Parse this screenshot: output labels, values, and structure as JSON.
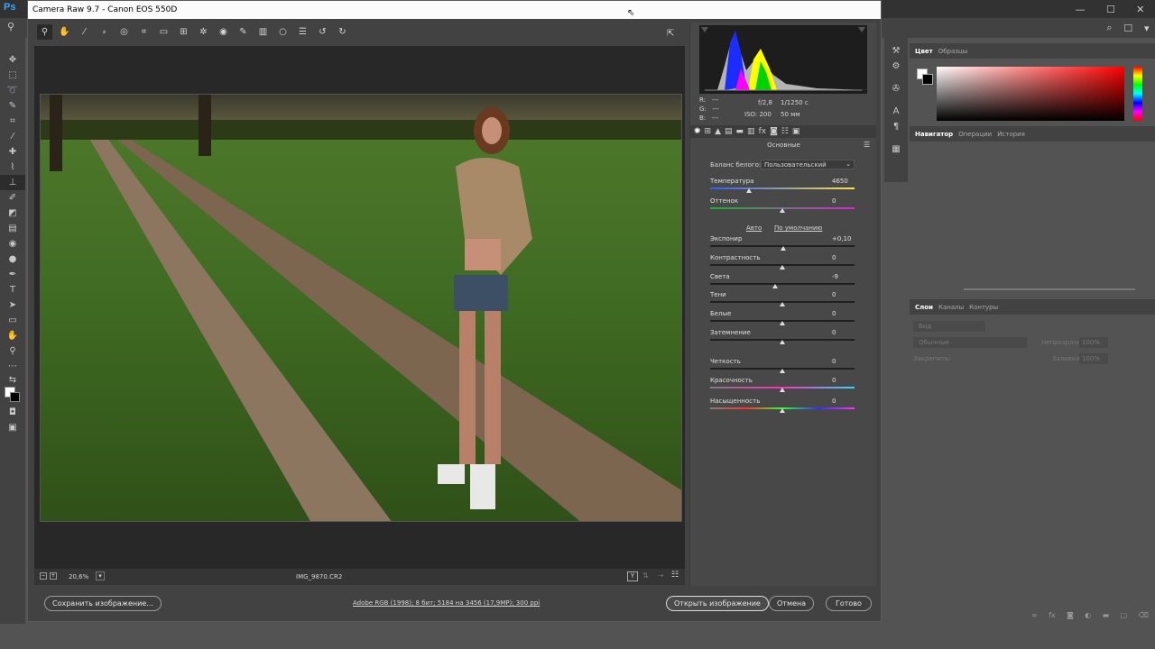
{
  "ps": {
    "logo": "Ps",
    "controls": [
      "—",
      "☐",
      "✕"
    ],
    "right_icons": [
      "⌕",
      "☐",
      "▾"
    ]
  },
  "acr": {
    "title": "Camera Raw 9.7  -  Canon EOS 550D",
    "preview": {
      "zoom": "20,6%",
      "filename": "IMG_9870.CR2"
    },
    "histogram": {
      "rgb": [
        {
          "k": "R:",
          "v": "---"
        },
        {
          "k": "G:",
          "v": "---"
        },
        {
          "k": "B:",
          "v": "---"
        }
      ],
      "aperture": "f/2,8",
      "shutter": "1/1250 с",
      "iso": "ISO: 200",
      "focal": "50 мм"
    },
    "panel_title": "Основные",
    "wb_label": "Баланс белого:",
    "wb_value": "Пользовательский",
    "auto": "Авто",
    "defaults": "По умолчанию",
    "sliders": [
      {
        "label": "Температура",
        "value": "4650",
        "pos": 0.27,
        "style": "temp"
      },
      {
        "label": "Оттенок",
        "value": "0",
        "pos": 0.5,
        "style": "tint"
      },
      {
        "label": "Экспонир",
        "value": "+0,10",
        "pos": 0.505,
        "style": "gray"
      },
      {
        "label": "Контрастность",
        "value": "0",
        "pos": 0.5,
        "style": "gray"
      },
      {
        "label": "Света",
        "value": "-9",
        "pos": 0.45,
        "style": "gray"
      },
      {
        "label": "Тени",
        "value": "0",
        "pos": 0.5,
        "style": "gray"
      },
      {
        "label": "Белые",
        "value": "0",
        "pos": 0.5,
        "style": "gray"
      },
      {
        "label": "Затемнение",
        "value": "0",
        "pos": 0.5,
        "style": "gray"
      },
      {
        "label": "Четкость",
        "value": "0",
        "pos": 0.5,
        "style": "gray"
      },
      {
        "label": "Красочность",
        "value": "0",
        "pos": 0.5,
        "style": "vib"
      },
      {
        "label": "Насыщенность",
        "value": "0",
        "pos": 0.5,
        "style": "sat"
      }
    ],
    "footer": {
      "save": "Сохранить изображение...",
      "workflow": "Adobe RGB (1998); 8 бит; 5184 на 3456 (17,9МР); 300 ppi",
      "open": "Открыть изображение",
      "cancel": "Отмена",
      "done": "Готово"
    }
  },
  "panels": {
    "color": {
      "tabs": [
        "Цвет",
        "Образцы"
      ]
    },
    "nav": {
      "tabs": [
        "Навигатор",
        "Операции",
        "История"
      ]
    },
    "layers": {
      "tabs": [
        "Слои",
        "Каналы",
        "Контуры"
      ],
      "kind": "Вид",
      "blend": "Обычные",
      "opacity_label": "Непрозрачность:",
      "opacity": "100%",
      "lock_label": "Закрепить:",
      "fill_label": "Заливка:",
      "fill": "100%"
    }
  },
  "colors": {
    "accent": "#31a8ff",
    "titlebar": "#fbfbfb"
  }
}
